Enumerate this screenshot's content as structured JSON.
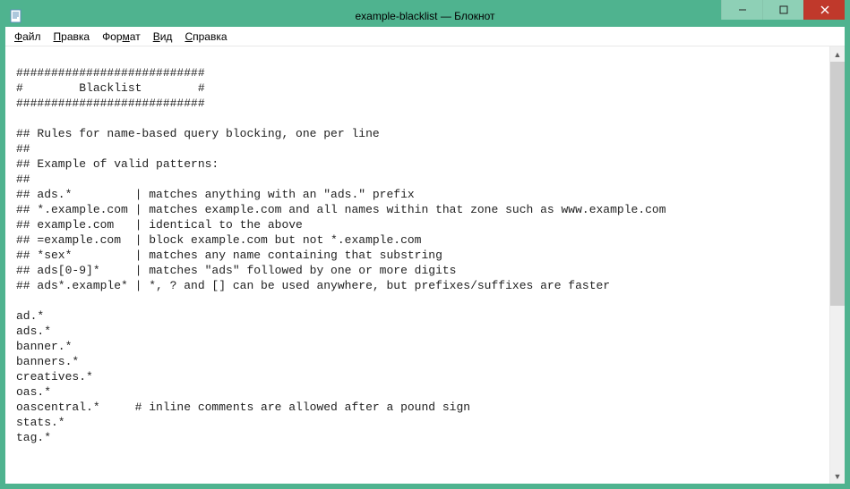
{
  "window": {
    "title": "example-blacklist — Блокнот"
  },
  "menubar": {
    "file": {
      "label": "Файл",
      "underline_index": 0
    },
    "edit": {
      "label": "Правка",
      "underline_index": 0
    },
    "format": {
      "label": "Формат",
      "underline_index": 3
    },
    "view": {
      "label": "Вид",
      "underline_index": 0
    },
    "help": {
      "label": "Справка",
      "underline_index": 0
    }
  },
  "editor": {
    "lines": [
      "",
      "###########################",
      "#        Blacklist        #",
      "###########################",
      "",
      "## Rules for name-based query blocking, one per line",
      "##",
      "## Example of valid patterns:",
      "##",
      "## ads.*         | matches anything with an \"ads.\" prefix",
      "## *.example.com | matches example.com and all names within that zone such as www.example.com",
      "## example.com   | identical to the above",
      "## =example.com  | block example.com but not *.example.com",
      "## *sex*         | matches any name containing that substring",
      "## ads[0-9]*     | matches \"ads\" followed by one or more digits",
      "## ads*.example* | *, ? and [] can be used anywhere, but prefixes/suffixes are faster",
      "",
      "ad.*",
      "ads.*",
      "banner.*",
      "banners.*",
      "creatives.*",
      "oas.*",
      "oascentral.*     # inline comments are allowed after a pound sign",
      "stats.*",
      "tag.*"
    ]
  },
  "colors": {
    "window_frame": "#4fb38f",
    "close_button": "#c0392b",
    "control_bg": "#8ed0b6",
    "background": "#ffffff"
  }
}
